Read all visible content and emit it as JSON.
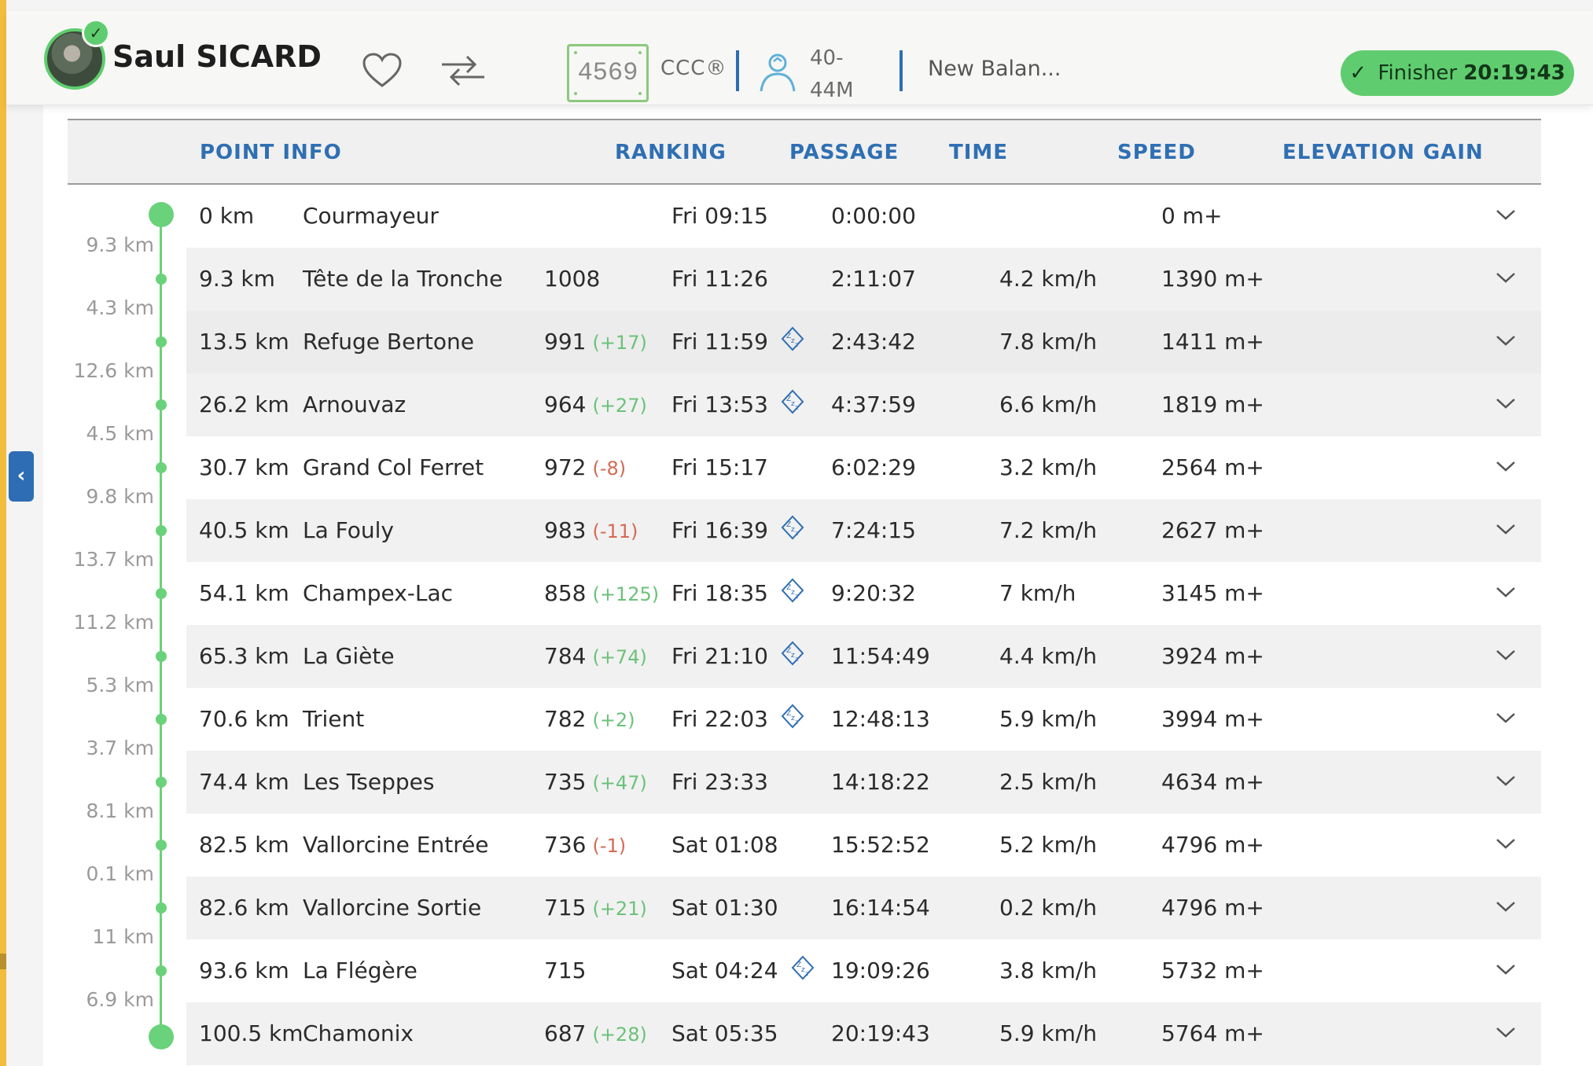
{
  "header": {
    "athlete_name": "Saul SICARD",
    "bib": "4569",
    "race": "CCC®",
    "category": "40-44M",
    "team": "New Balan...",
    "finisher_label": "Finisher",
    "finisher_time": "20:19:43",
    "accent_color": "#5fcd6f",
    "brand_blue": "#2e6db3"
  },
  "table": {
    "headers": {
      "point_info": "POINT INFO",
      "ranking": "RANKING",
      "passage": "PASSAGE",
      "time": "TIME",
      "speed": "SPEED",
      "elevation": "ELEVATION GAIN"
    },
    "segments": [
      "9.3 km",
      "4.3 km",
      "12.6 km",
      "4.5 km",
      "9.8 km",
      "13.7 km",
      "11.2 km",
      "5.3 km",
      "3.7 km",
      "8.1 km",
      "0.1 km",
      "11 km",
      "6.9 km"
    ],
    "rows": [
      {
        "km": "0 km",
        "name": "Courmayeur",
        "rank": "",
        "delta": "",
        "delta_dir": "",
        "passage": "Fri 09:15",
        "sleep": false,
        "time": "0:00:00",
        "speed": "",
        "elev": "0 m+"
      },
      {
        "km": "9.3 km",
        "name": "Tête de la Tronche",
        "rank": "1008",
        "delta": "",
        "delta_dir": "",
        "passage": "Fri 11:26",
        "sleep": false,
        "time": "2:11:07",
        "speed": "4.2 km/h",
        "elev": "1390 m+"
      },
      {
        "km": "13.5 km",
        "name": "Refuge Bertone",
        "rank": "991",
        "delta": "(+17)",
        "delta_dir": "up",
        "passage": "Fri 11:59",
        "sleep": true,
        "time": "2:43:42",
        "speed": "7.8 km/h",
        "elev": "1411 m+"
      },
      {
        "km": "26.2 km",
        "name": "Arnouvaz",
        "rank": "964",
        "delta": "(+27)",
        "delta_dir": "up",
        "passage": "Fri 13:53",
        "sleep": true,
        "time": "4:37:59",
        "speed": "6.6 km/h",
        "elev": "1819 m+"
      },
      {
        "km": "30.7 km",
        "name": "Grand Col Ferret",
        "rank": "972",
        "delta": "(-8)",
        "delta_dir": "down",
        "passage": "Fri 15:17",
        "sleep": false,
        "time": "6:02:29",
        "speed": "3.2 km/h",
        "elev": "2564 m+"
      },
      {
        "km": "40.5 km",
        "name": "La Fouly",
        "rank": "983",
        "delta": "(-11)",
        "delta_dir": "down",
        "passage": "Fri 16:39",
        "sleep": true,
        "time": "7:24:15",
        "speed": "7.2 km/h",
        "elev": "2627 m+"
      },
      {
        "km": "54.1 km",
        "name": "Champex-Lac",
        "rank": "858",
        "delta": "(+125)",
        "delta_dir": "up",
        "passage": "Fri 18:35",
        "sleep": true,
        "time": "9:20:32",
        "speed": "7 km/h",
        "elev": "3145 m+"
      },
      {
        "km": "65.3 km",
        "name": "La Giète",
        "rank": "784",
        "delta": "(+74)",
        "delta_dir": "up",
        "passage": "Fri 21:10",
        "sleep": true,
        "time": "11:54:49",
        "speed": "4.4 km/h",
        "elev": "3924 m+"
      },
      {
        "km": "70.6 km",
        "name": "Trient",
        "rank": "782",
        "delta": "(+2)",
        "delta_dir": "up",
        "passage": "Fri 22:03",
        "sleep": true,
        "time": "12:48:13",
        "speed": "5.9 km/h",
        "elev": "3994 m+"
      },
      {
        "km": "74.4 km",
        "name": "Les Tseppes",
        "rank": "735",
        "delta": "(+47)",
        "delta_dir": "up",
        "passage": "Fri 23:33",
        "sleep": false,
        "time": "14:18:22",
        "speed": "2.5 km/h",
        "elev": "4634 m+"
      },
      {
        "km": "82.5 km",
        "name": "Vallorcine Entrée",
        "rank": "736",
        "delta": "(-1)",
        "delta_dir": "down",
        "passage": "Sat 01:08",
        "sleep": false,
        "time": "15:52:52",
        "speed": "5.2 km/h",
        "elev": "4796 m+"
      },
      {
        "km": "82.6 km",
        "name": "Vallorcine Sortie",
        "rank": "715",
        "delta": "(+21)",
        "delta_dir": "up",
        "passage": "Sat 01:30",
        "sleep": false,
        "time": "16:14:54",
        "speed": "0.2 km/h",
        "elev": "4796 m+"
      },
      {
        "km": "93.6 km",
        "name": "La Flégère",
        "rank": "715",
        "delta": "",
        "delta_dir": "",
        "passage": "Sat 04:24",
        "sleep": true,
        "time": "19:09:26",
        "speed": "3.8 km/h",
        "elev": "5732 m+"
      },
      {
        "km": "100.5 km",
        "name": "Chamonix",
        "rank": "687",
        "delta": "(+28)",
        "delta_dir": "up",
        "passage": "Sat 05:35",
        "sleep": false,
        "time": "20:19:43",
        "speed": "5.9 km/h",
        "elev": "5764 m+"
      }
    ]
  }
}
